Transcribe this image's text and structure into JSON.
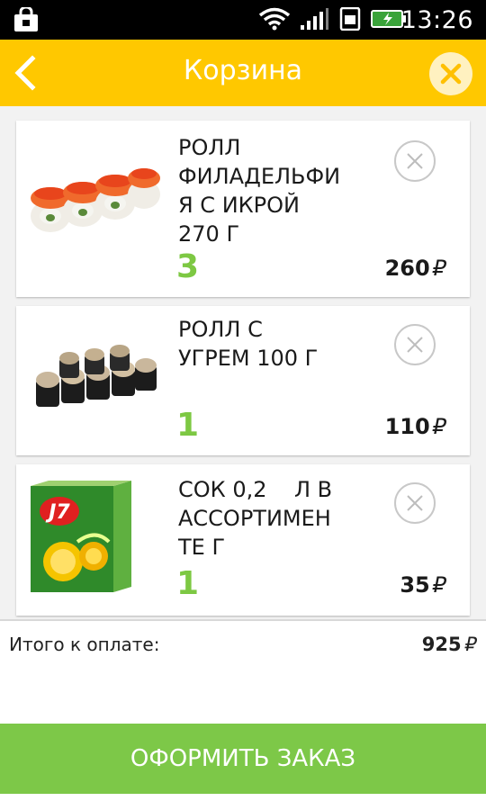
{
  "status_bar": {
    "time": "13:26",
    "icons": [
      "shopping-bag-icon",
      "wifi-icon",
      "signal-icon",
      "sim-icon",
      "battery-icon"
    ]
  },
  "header": {
    "title": "Корзина",
    "back_icon": "chevron-left-icon",
    "close_icon": "close-icon",
    "accent_color": "#ffc800"
  },
  "cart": {
    "items": [
      {
        "name": "РОЛЛ ФИЛАДЕЛЬФИ Я С ИКРОЙ 270 Г",
        "name_lines": [
          "РОЛЛ",
          "ФИЛАДЕЛЬФИ",
          "Я С ИКРОЙ",
          "270 Г"
        ],
        "quantity": "3",
        "price": "260",
        "currency": "₽"
      },
      {
        "name": "РОЛЛ С УГРЕМ 100 Г",
        "name_lines": [
          "РОЛЛ С",
          "УГРЕМ 100 Г"
        ],
        "quantity": "1",
        "price": "110",
        "currency": "₽"
      },
      {
        "name": "СОК 0,2 Л В АССОРТИМЕН ТЕ Г",
        "name_lines": [
          "СОК 0,2    Л В",
          "АССОРТИМЕН",
          "ТЕ Г"
        ],
        "quantity": "1",
        "price": "35",
        "currency": "₽"
      }
    ]
  },
  "total": {
    "label": "Итого к оплате:",
    "amount": "925",
    "currency": "₽"
  },
  "order_button": {
    "label": "ОФОРМИТЬ ЗАКАЗ",
    "color": "#7dc848"
  },
  "colors": {
    "quantity": "#7dc843",
    "header": "#ffc800",
    "list_background": "#f2f2f2"
  }
}
